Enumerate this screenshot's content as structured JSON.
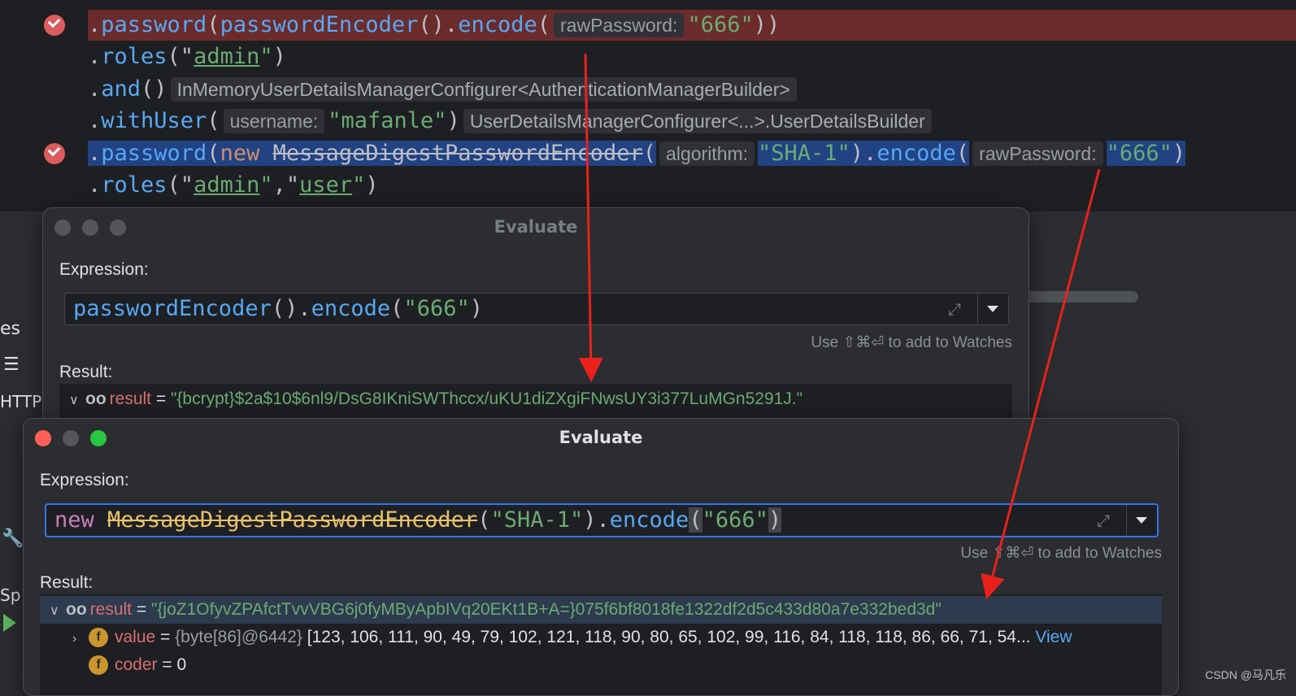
{
  "editor": {
    "line1": {
      "m1": "password",
      "m2": "passwordEncoder",
      "m3": "encode",
      "hint": "rawPassword:",
      "arg": "\"666\"",
      "close": "))"
    },
    "line2": {
      "m": "roles",
      "arg": "admin"
    },
    "line3": {
      "m": "and",
      "type_hint": "InMemoryUserDetailsManagerConfigurer<AuthenticationManagerBuilder>"
    },
    "line4": {
      "m": "withUser",
      "hint": "username:",
      "arg": "\"mafanle\"",
      "type_hint": "UserDetailsManagerConfigurer<...>.UserDetailsBuilder"
    },
    "line5": {
      "m": "password",
      "kw": "new",
      "cls": "MessageDigestPasswordEncoder",
      "hint1": "algorithm:",
      "arg1": "\"SHA-1\"",
      "m2": "encode",
      "hint2": "rawPassword:",
      "arg2": "\"666\""
    },
    "line6": {
      "m": "roles",
      "arg1": "admin",
      "arg2": "user"
    }
  },
  "side": {
    "t1": "es",
    "t2": "HTTP",
    "t3": "Sp"
  },
  "dialog1": {
    "title": "Evaluate",
    "expression_label": "Expression:",
    "expr": {
      "m1": "passwordEncoder",
      "m2": "encode",
      "arg": "\"666\""
    },
    "watch_hint": "Use ⇧⌘⏎ to add to Watches",
    "result_label": "Result:",
    "result": {
      "name": "result",
      "value": "\"{bcrypt}$2a$10$6nl9/DsG8IKniSWThccx/uKU1diZXgiFNwsUY3i377LuMGn5291J.\""
    }
  },
  "dialog2": {
    "title": "Evaluate",
    "expression_label": "Expression:",
    "expr": {
      "kw": "new",
      "cls": "MessageDigestPasswordEncoder",
      "arg1": "\"SHA-1\"",
      "m": "encode",
      "arg2": "\"666\""
    },
    "watch_hint": "Use ⇧⌘⏎ to add to Watches",
    "result_label": "Result:",
    "result": {
      "name": "result",
      "value": "\"{joZ1OfyvZPAfctTvvVBG6j0fyMByApbIVq20EKt1B+A=}075f6bf8018fe1322df2d5c433d80a7e332bed3d\""
    },
    "field_value": {
      "name": "value",
      "type": "{byte[86]@6442}",
      "preview": "[123, 106, 111, 90, 49, 79, 102, 121, 118, 90, 80, 65, 102, 99, 116, 84, 118, 118, 86, 66, 71, 54...",
      "link": "View"
    },
    "field_coder": {
      "name": "coder",
      "value": "0"
    }
  },
  "watermark": "CSDN @马凡乐",
  "colors": {
    "breakpoint_line": "#6b2b2b",
    "arrow": "#e8221b",
    "string": "#6aab73",
    "method": "#56a8f5",
    "keyword": "#cf8e6d"
  }
}
